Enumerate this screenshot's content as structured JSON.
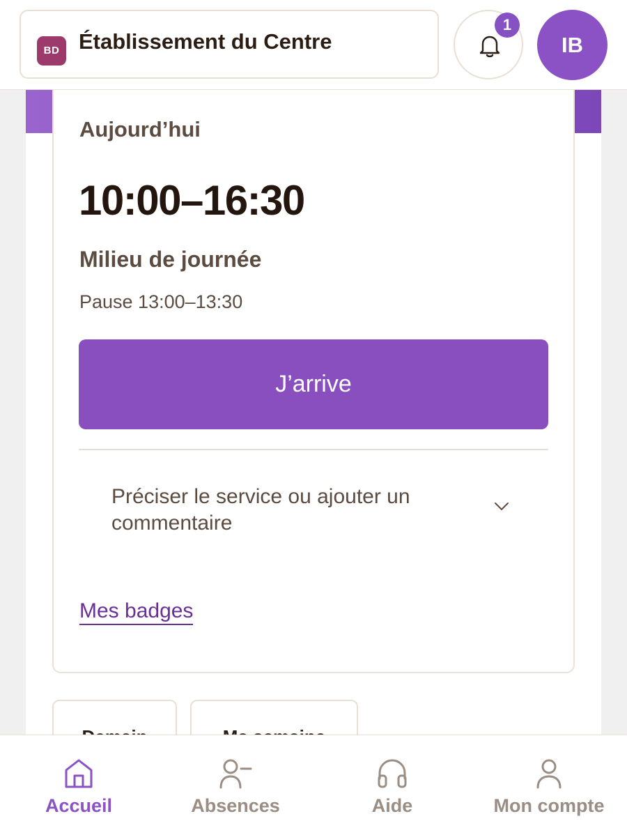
{
  "header": {
    "org_badge": "BD",
    "org_name": "Établissement du Centre",
    "notification_count": "1",
    "avatar_initials": "IB"
  },
  "today": {
    "label": "Aujourd’hui",
    "time_range": "10:00–16:30",
    "shift_name": "Milieu de journée",
    "pause": "Pause 13:00–13:30",
    "arrive_button": "J’arrive",
    "precise_text": "Préciser le service ou ajouter un commentaire",
    "badges_link": "Mes badges"
  },
  "chips": [
    "Demain",
    "Ma semaine"
  ],
  "nav": {
    "items": [
      {
        "label": "Accueil",
        "icon": "home-icon",
        "active": true
      },
      {
        "label": "Absences",
        "icon": "user-minus-icon",
        "active": false
      },
      {
        "label": "Aide",
        "icon": "headphones-icon",
        "active": false
      },
      {
        "label": "Mon compte",
        "icon": "user-icon",
        "active": false
      }
    ]
  },
  "colors": {
    "accent": "#8a52c5",
    "org_badge": "#9c3b6b",
    "link": "#6a2f97",
    "muted_text": "#5b4b41",
    "nav_inactive": "#9a8d83"
  }
}
